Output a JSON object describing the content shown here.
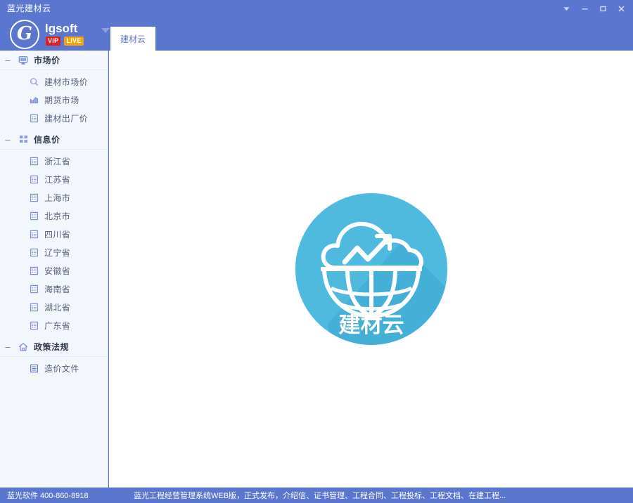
{
  "window": {
    "title": "蓝光建材云",
    "controls": [
      {
        "name": "menu-chevron-button",
        "glyph": "▼"
      },
      {
        "name": "minimize-button",
        "glyph": "–"
      },
      {
        "name": "maximize-button",
        "glyph": "▫"
      },
      {
        "name": "close-button",
        "glyph": "✕"
      }
    ]
  },
  "brand": {
    "logo_letter": "G",
    "name": "lgsoft",
    "badges": [
      {
        "label": "VIP",
        "color": "#e02020"
      },
      {
        "label": "LIVE",
        "color": "#f2a40c"
      }
    ]
  },
  "tabs": [
    {
      "label": "建材云",
      "active": true
    }
  ],
  "sidebar": {
    "groups": [
      {
        "title": "市场价",
        "icon": "monitor-icon",
        "expanded": true,
        "toggle_glyph": "–",
        "items": [
          {
            "label": "建材市场价",
            "icon": "search-icon"
          },
          {
            "label": "期货市场",
            "icon": "chart-icon"
          },
          {
            "label": "建材出厂价",
            "icon": "list-icon"
          }
        ]
      },
      {
        "title": "信息价",
        "icon": "grid-icon",
        "expanded": true,
        "toggle_glyph": "–",
        "items": [
          {
            "label": "浙江省",
            "icon": "list-icon"
          },
          {
            "label": "江苏省",
            "icon": "list-icon"
          },
          {
            "label": "上海市",
            "icon": "list-icon"
          },
          {
            "label": "北京市",
            "icon": "list-icon"
          },
          {
            "label": "四川省",
            "icon": "list-icon"
          },
          {
            "label": "辽宁省",
            "icon": "list-icon"
          },
          {
            "label": "安徽省",
            "icon": "list-icon"
          },
          {
            "label": "海南省",
            "icon": "list-icon"
          },
          {
            "label": "湖北省",
            "icon": "list-icon"
          },
          {
            "label": "广东省",
            "icon": "list-icon"
          }
        ]
      },
      {
        "title": "政策法规",
        "icon": "home-icon",
        "expanded": true,
        "toggle_glyph": "–",
        "items": [
          {
            "label": "造价文件",
            "icon": "document-icon"
          }
        ]
      }
    ]
  },
  "main": {
    "hero": {
      "name": "jiancaiyun-logo",
      "caption": "建材云",
      "circle_color": "#4fb9de",
      "shadow_color": "#3fa8cf",
      "mark_color": "#ffffff"
    }
  },
  "footer": {
    "contact": "蓝光软件 400-860-8918",
    "marquee": "蓝光工程经营管理系统WEB版，正式发布，介绍信、证书管理、工程合同、工程投标、工程文档、在建工程..."
  },
  "colors": {
    "chrome_blue": "#5b76ce",
    "sidebar_bg": "#f3f6fc",
    "accent_cyan": "#4fb9de"
  }
}
